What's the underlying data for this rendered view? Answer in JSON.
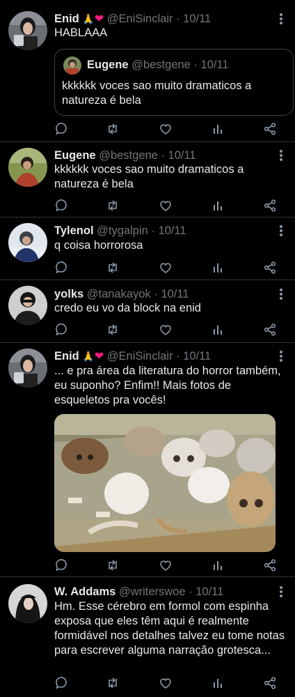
{
  "colors": {
    "background": "#000000",
    "text": "#e7e9ea",
    "secondary": "#71767b",
    "divider": "#2f3336",
    "like": "#f91880"
  },
  "action_icons": [
    "reply-icon",
    "retweet-icon",
    "like-icon",
    "analytics-icon",
    "share-icon"
  ],
  "tweets": [
    {
      "name": "Enid",
      "emoji": "🙏",
      "heart": "❤",
      "handle": "@EniSinclair",
      "time": "· 10/11",
      "text": "HABLAAA",
      "quote": {
        "name": "Eugene",
        "handle": "@bestgene",
        "time": "· 10/11",
        "text": "kkkkkk voces sao muito dramaticos a natureza é bela"
      }
    },
    {
      "name": "Eugene",
      "handle": "@bestgene",
      "time": "· 10/11",
      "text": "kkkkkk voces sao muito dramaticos a natureza é bela"
    },
    {
      "name": "Tylenol",
      "handle": "@tygalpin",
      "time": "· 10/11",
      "text": "q coisa horrorosa"
    },
    {
      "name": "yolks",
      "handle": "@tanakayok",
      "time": "· 10/11",
      "text": "credo eu vo da block na enid"
    },
    {
      "name": "Enid",
      "emoji": "🙏",
      "heart": "❤",
      "handle": "@EniSinclair",
      "time": "· 10/11",
      "text": "... e pra área da literatura do horror também, eu suponho? Enfim!! Mais fotos de esqueletos pra vocês!",
      "media": "skulls-photo"
    },
    {
      "name": "W. Addams",
      "handle": "@writerswoe",
      "time": "· 10/11",
      "text": "Hm. Esse cérebro em formol com espinha exposa que eles têm aqui é realmente formidável nos detalhes talvez eu tome notas para escrever alguma narração grotesca..."
    }
  ]
}
